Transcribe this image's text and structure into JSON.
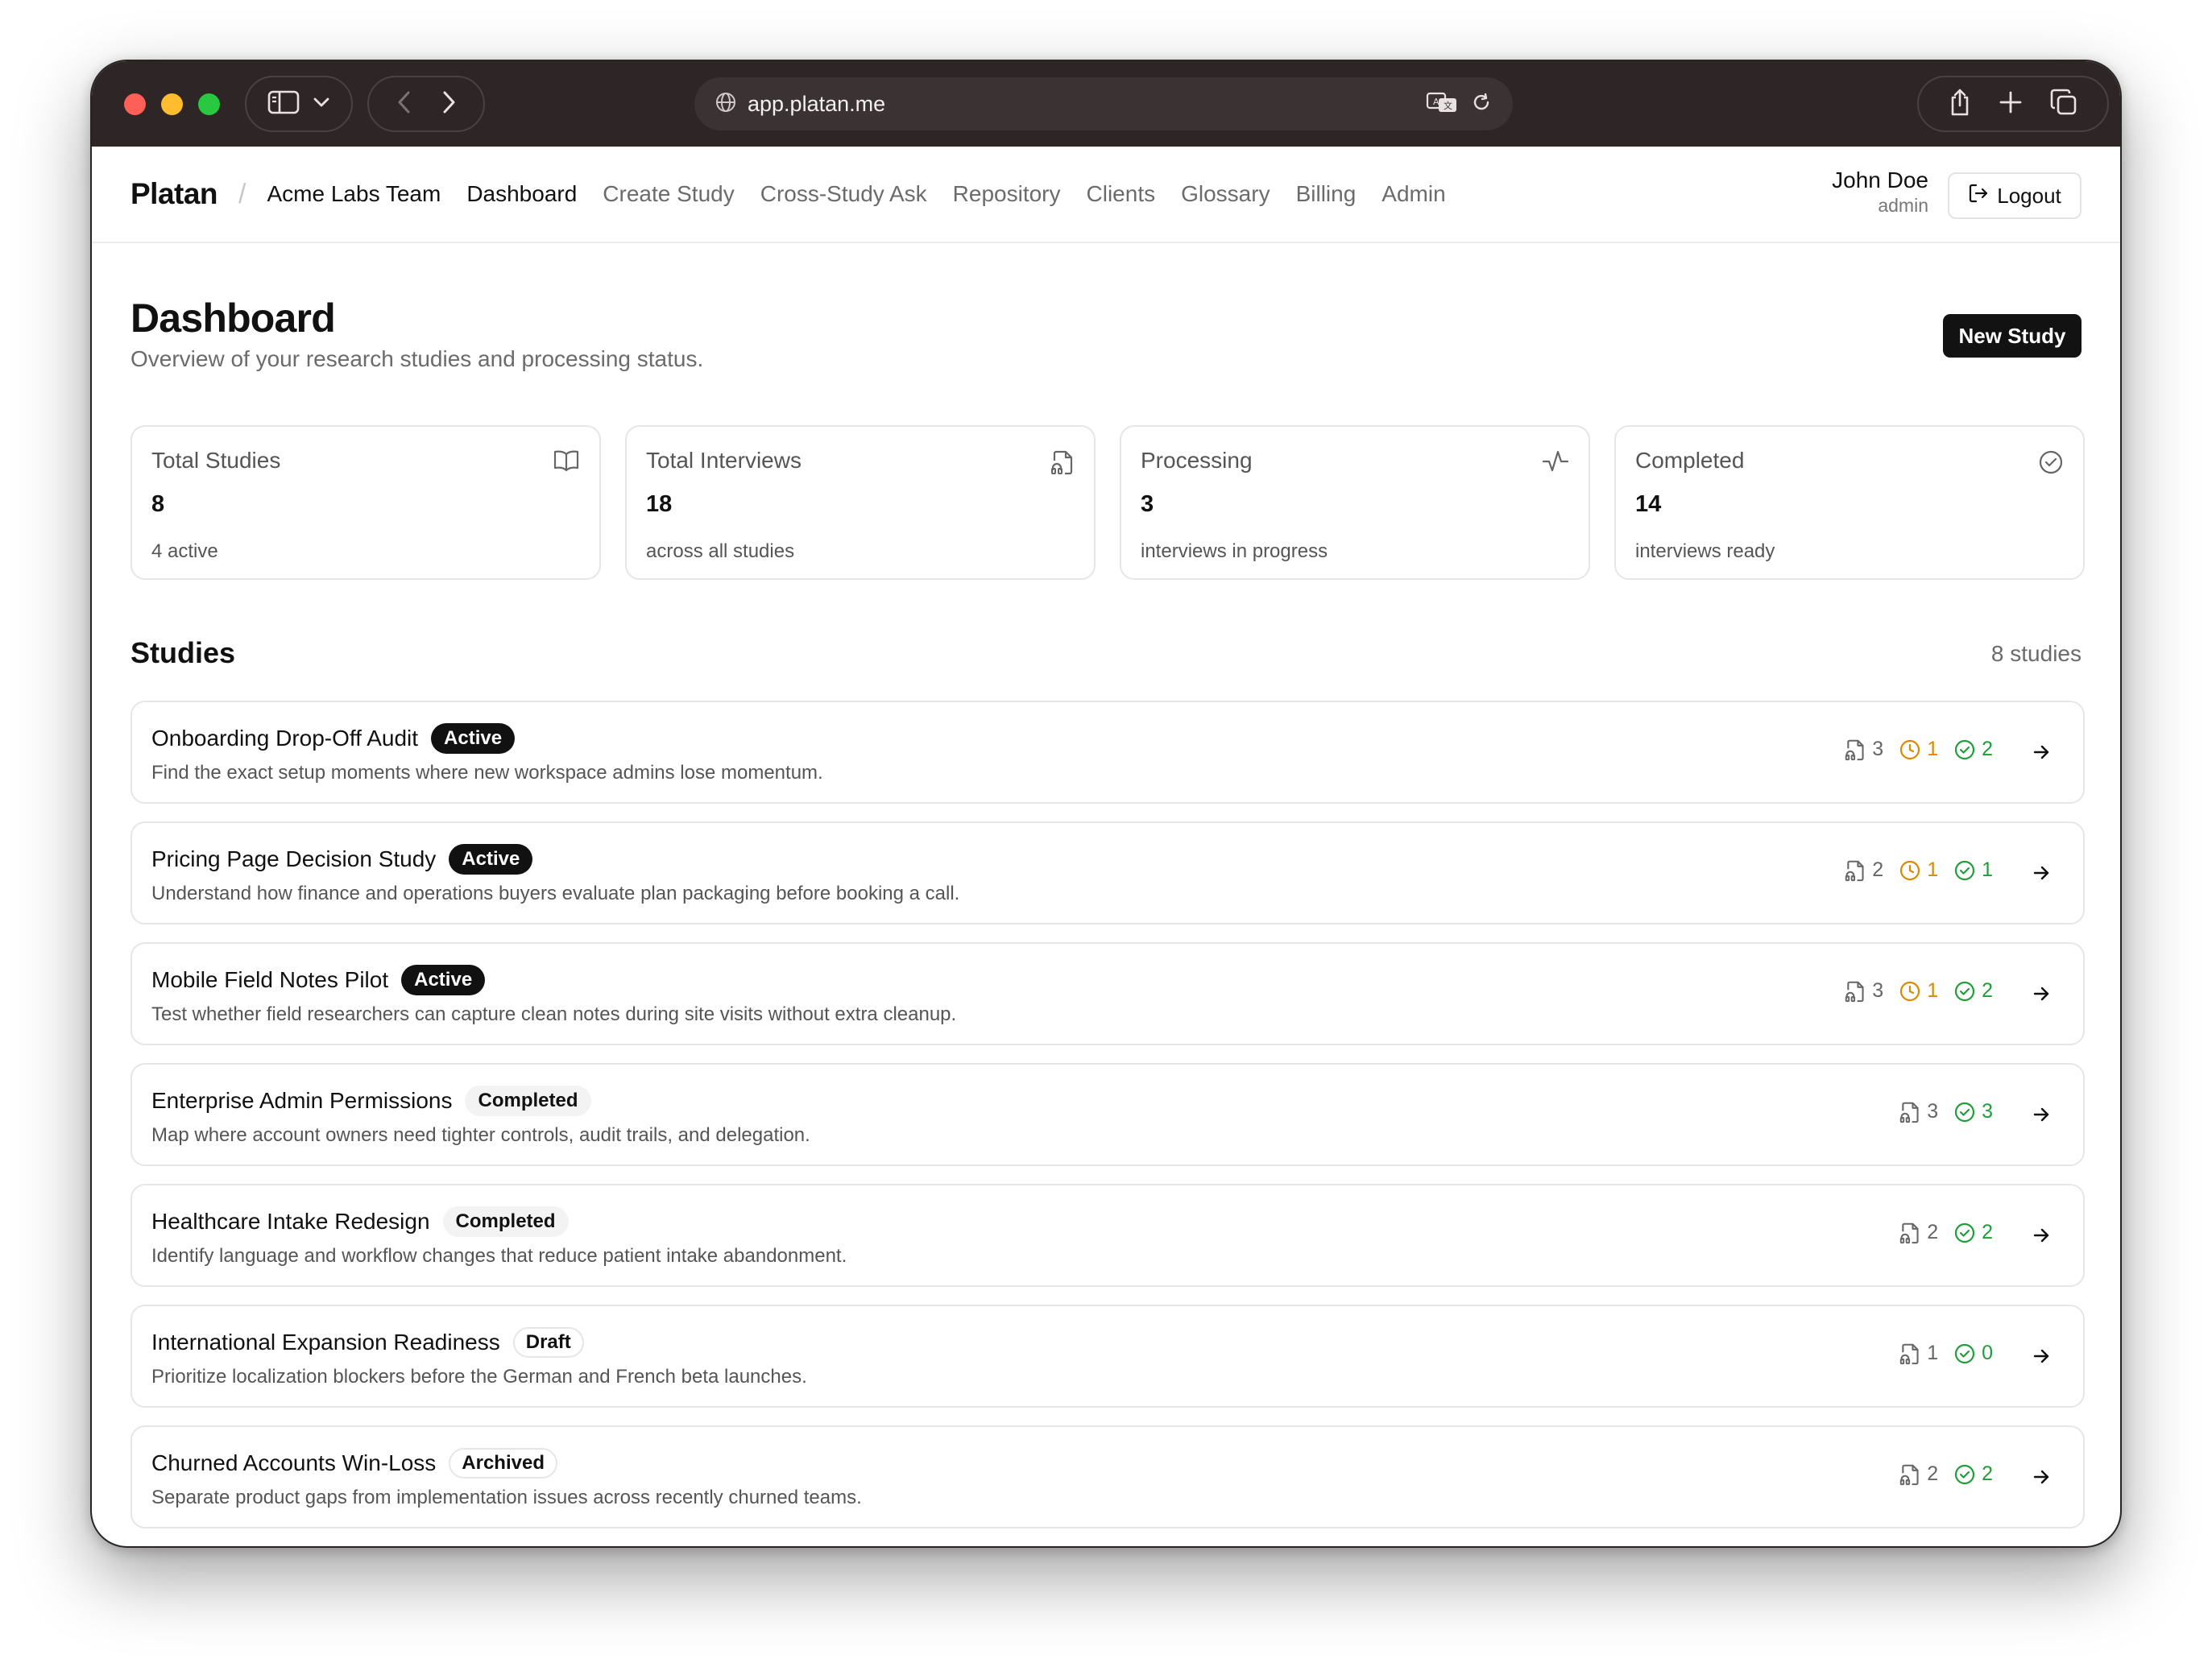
{
  "browser": {
    "url": "app.platan.me"
  },
  "header": {
    "brand": "Platan",
    "team": "Acme Labs Team",
    "nav": [
      {
        "label": "Dashboard",
        "active": true
      },
      {
        "label": "Create Study",
        "active": false
      },
      {
        "label": "Cross-Study Ask",
        "active": false
      },
      {
        "label": "Repository",
        "active": false
      },
      {
        "label": "Clients",
        "active": false
      },
      {
        "label": "Glossary",
        "active": false
      },
      {
        "label": "Billing",
        "active": false
      },
      {
        "label": "Admin",
        "active": false
      }
    ],
    "user": {
      "name": "John Doe",
      "role": "admin"
    },
    "logout_label": "Logout"
  },
  "page": {
    "title": "Dashboard",
    "subtitle": "Overview of your research studies and processing status.",
    "new_study_label": "New Study"
  },
  "stats": [
    {
      "label": "Total Studies",
      "value": "8",
      "note": "4 active",
      "icon": "book-open-icon"
    },
    {
      "label": "Total Interviews",
      "value": "18",
      "note": "across all studies",
      "icon": "file-audio-icon"
    },
    {
      "label": "Processing",
      "value": "3",
      "note": "interviews in progress",
      "icon": "activity-icon"
    },
    {
      "label": "Completed",
      "value": "14",
      "note": "interviews ready",
      "icon": "check-circle-icon"
    }
  ],
  "studies": {
    "title": "Studies",
    "count": "8 studies",
    "items": [
      {
        "name": "Onboarding Drop-Off Audit",
        "status": "Active",
        "desc": "Find the exact setup moments where new workspace admins lose momentum.",
        "interviews": "3",
        "pending": "1",
        "ready": "2"
      },
      {
        "name": "Pricing Page Decision Study",
        "status": "Active",
        "desc": "Understand how finance and operations buyers evaluate plan packaging before booking a call.",
        "interviews": "2",
        "pending": "1",
        "ready": "1"
      },
      {
        "name": "Mobile Field Notes Pilot",
        "status": "Active",
        "desc": "Test whether field researchers can capture clean notes during site visits without extra cleanup.",
        "interviews": "3",
        "pending": "1",
        "ready": "2"
      },
      {
        "name": "Enterprise Admin Permissions",
        "status": "Completed",
        "desc": "Map where account owners need tighter controls, audit trails, and delegation.",
        "interviews": "3",
        "pending": null,
        "ready": "3"
      },
      {
        "name": "Healthcare Intake Redesign",
        "status": "Completed",
        "desc": "Identify language and workflow changes that reduce patient intake abandonment.",
        "interviews": "2",
        "pending": null,
        "ready": "2"
      },
      {
        "name": "International Expansion Readiness",
        "status": "Draft",
        "desc": "Prioritize localization blockers before the German and French beta launches.",
        "interviews": "1",
        "pending": null,
        "ready": "0"
      },
      {
        "name": "Churned Accounts Win-Loss",
        "status": "Archived",
        "desc": "Separate product gaps from implementation issues across recently churned teams.",
        "interviews": "2",
        "pending": null,
        "ready": "2"
      }
    ]
  },
  "colors": {
    "chrome": "#2d2526",
    "pending": "#d98a00",
    "ready": "#1f9d3a",
    "primary_button": "#121212"
  }
}
